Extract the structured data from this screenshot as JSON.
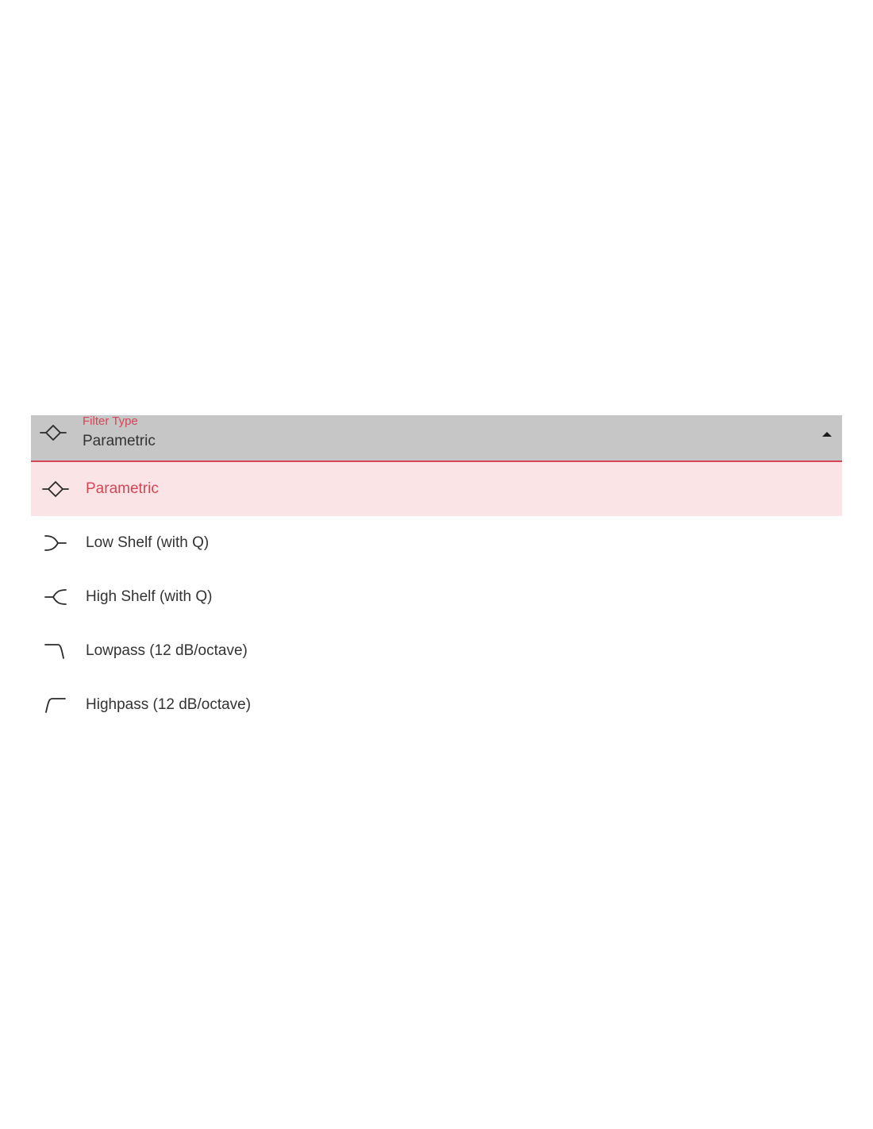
{
  "theme": {
    "accent": "#d34655",
    "field_background": "#c6c6c6",
    "selected_background": "#fbe4e6",
    "text": "#333333"
  },
  "select": {
    "label": "Filter Type",
    "value": "Parametric",
    "value_icon": "parametric-filter-icon",
    "expanded": true,
    "arrow_icon": "arrow-up-icon"
  },
  "menu": {
    "items": [
      {
        "label": "Parametric",
        "icon": "parametric-filter-icon",
        "selected": true
      },
      {
        "label": "Low Shelf (with Q)",
        "icon": "low-shelf-filter-icon",
        "selected": false
      },
      {
        "label": "High Shelf (with Q)",
        "icon": "high-shelf-filter-icon",
        "selected": false
      },
      {
        "label": "Lowpass (12 dB/octave)",
        "icon": "lowpass-filter-icon",
        "selected": false
      },
      {
        "label": "Highpass (12 dB/octave)",
        "icon": "highpass-filter-icon",
        "selected": false
      }
    ]
  }
}
